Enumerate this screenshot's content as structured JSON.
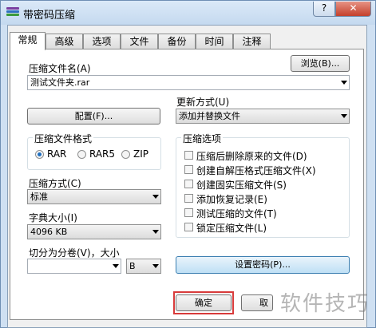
{
  "window": {
    "title": "带密码压缩",
    "help_label": "?",
    "close_label": "✕"
  },
  "tabs": [
    "常规",
    "高级",
    "选项",
    "文件",
    "备份",
    "时间",
    "注释"
  ],
  "archive": {
    "name_label": "压缩文件名(A)",
    "name_value": "测试文件夹.rar",
    "browse_label": "浏览(B)..."
  },
  "update": {
    "label": "更新方式(U)",
    "value": "添加并替换文件"
  },
  "profiles_label": "配置(F)...",
  "format": {
    "title": "压缩文件格式",
    "options": [
      "RAR",
      "RAR5",
      "ZIP"
    ],
    "selected": "RAR"
  },
  "options": {
    "title": "压缩选项",
    "items": [
      "压缩后删除原来的文件(D)",
      "创建自解压格式压缩文件(X)",
      "创建固实压缩文件(S)",
      "添加恢复记录(E)",
      "测试压缩的文件(T)",
      "锁定压缩文件(L)"
    ]
  },
  "method": {
    "label": "压缩方式(C)",
    "value": "标准"
  },
  "dict": {
    "label": "字典大小(I)",
    "value": "4096 KB"
  },
  "split": {
    "label": "切分为分卷(V)，大小",
    "value": "",
    "unit": "B"
  },
  "set_password_label": "设置密码(P)...",
  "ok_label": "确定",
  "cancel_label_partial": "取",
  "watermark": "软件技巧",
  "colors": {
    "highlight": "#d83b3b",
    "close": "#c4402c",
    "focus": "#3c7fb1"
  }
}
